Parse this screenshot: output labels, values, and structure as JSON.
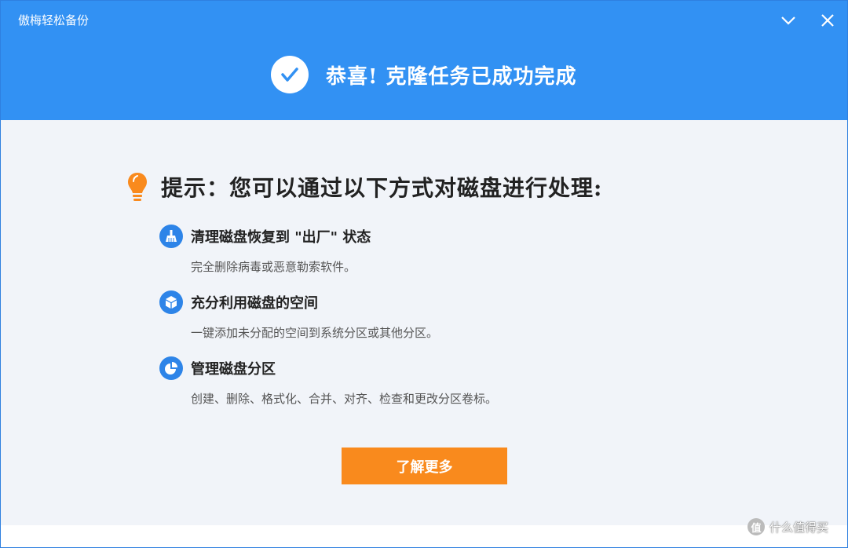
{
  "window": {
    "title": "傲梅轻松备份"
  },
  "banner": {
    "icon": "check-circle-icon",
    "text": "恭喜! 克隆任务已成功完成"
  },
  "tip": {
    "icon": "lightbulb-icon",
    "text": "提示：您可以通过以下方式对磁盘进行处理:"
  },
  "options": [
    {
      "icon": "broom-icon",
      "title": "清理磁盘恢复到 \"出厂\" 状态",
      "desc": "完全删除病毒或恶意勒索软件。"
    },
    {
      "icon": "box-icon",
      "title": "充分利用磁盘的空间",
      "desc": "一键添加未分配的空间到系统分区或其他分区。"
    },
    {
      "icon": "pie-chart-icon",
      "title": "管理磁盘分区",
      "desc": "创建、删除、格式化、合并、对齐、检查和更改分区卷标。"
    }
  ],
  "button": {
    "label": "了解更多"
  },
  "watermark": {
    "glyph": "值",
    "text": "什么值得买"
  },
  "colors": {
    "header": "#3291f3",
    "body": "#f1f4f9",
    "accent_icon": "#2d84e8",
    "button": "#f98a1d",
    "bulb": "#f98a1d"
  }
}
